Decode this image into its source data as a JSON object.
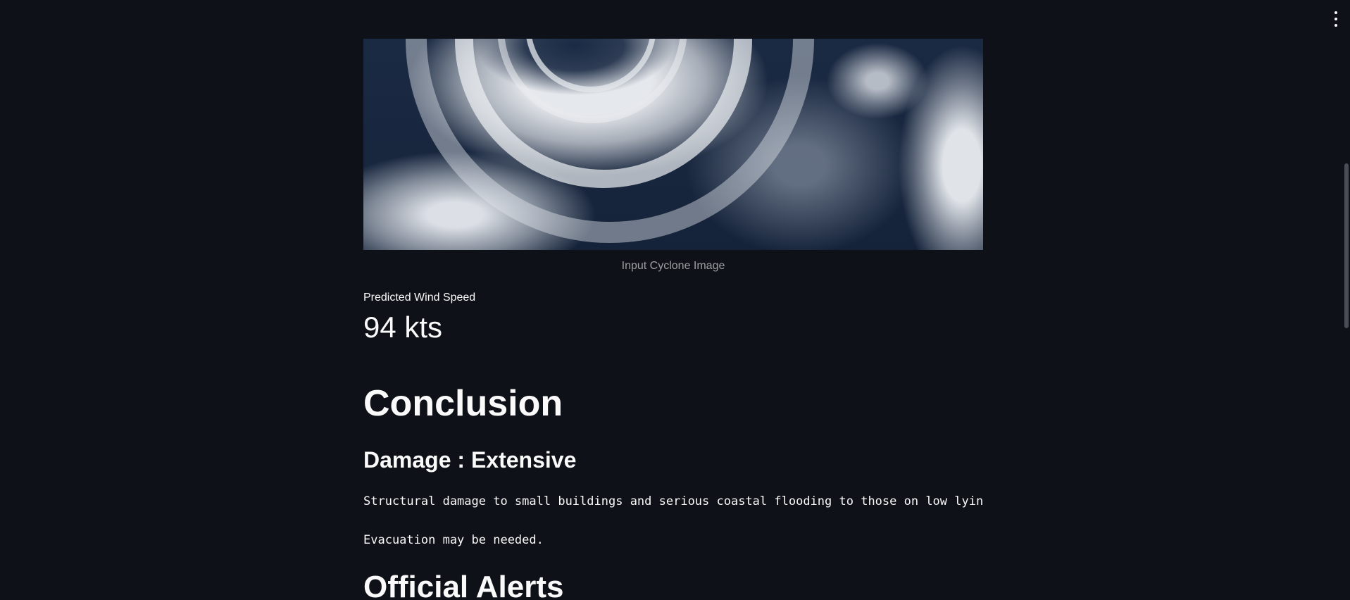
{
  "image": {
    "alt": "Input Cyclone Image",
    "caption": "Input Cyclone Image"
  },
  "metric": {
    "label": "Predicted Wind Speed",
    "value": "94 kts"
  },
  "conclusion": {
    "heading": "Conclusion",
    "damage_heading": "Damage : Extensive",
    "damage_description": "Structural damage to small buildings and serious coastal flooding to those on low lying land.",
    "evacuation_note": "Evacuation may be needed."
  },
  "alerts": {
    "heading": "Official Alerts"
  },
  "menu": {
    "icon": "vertical-ellipsis-icon"
  }
}
